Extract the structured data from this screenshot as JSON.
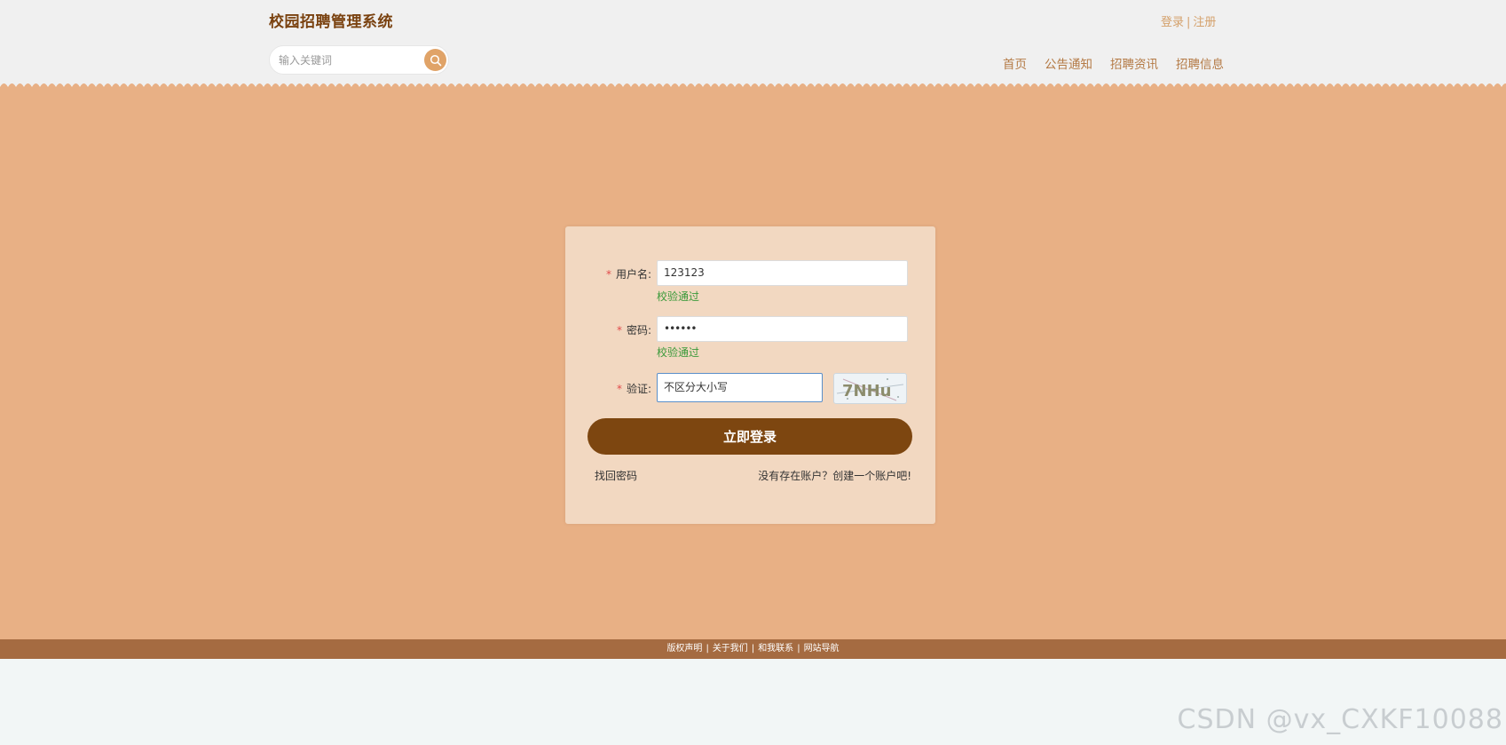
{
  "header": {
    "title": "校园招聘管理系统",
    "auth": {
      "login": "登录",
      "separator": "|",
      "register": "注册"
    },
    "search": {
      "placeholder": "输入关键词",
      "value": ""
    },
    "nav": [
      "首页",
      "公告通知",
      "招聘资讯",
      "招聘信息"
    ]
  },
  "colors": {
    "accent": "#e8b085",
    "brand_dark": "#7d4610",
    "card": "#f2d8c1",
    "footer": "#a56b41",
    "valid": "#3a9a3a"
  },
  "login_form": {
    "required_mark": "*",
    "username": {
      "label": "用户名:",
      "value": "123123",
      "status": "校验通过"
    },
    "password": {
      "label": "密码:",
      "value": "••••••",
      "status": "校验通过"
    },
    "captcha": {
      "label": "验证:",
      "value": "不区分大小写",
      "image_text": "7NHu"
    },
    "submit_label": "立即登录",
    "forgot_label": "找回密码",
    "register_label": "没有存在账户？创建一个账户吧!"
  },
  "footer": {
    "links": [
      "版权声明",
      "关于我们",
      "和我联系",
      "网站导航"
    ],
    "separator": "|"
  },
  "watermark": "CSDN @vx_CXKF10088"
}
